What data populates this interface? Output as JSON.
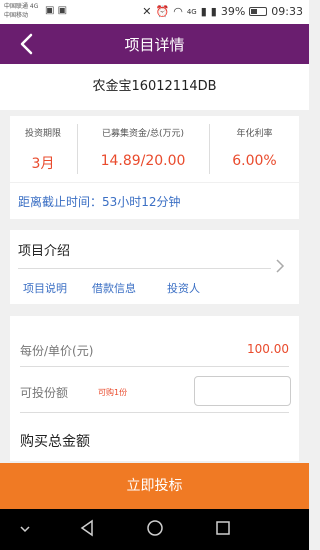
{
  "status_bar": {
    "carrier1": "中国联通 4G",
    "carrier2": "中国移动",
    "battery_percent": "39%",
    "time": "09:33",
    "network1": "4G",
    "battery_level": 0.39
  },
  "header": {
    "title": "项目详情"
  },
  "product": {
    "name": "农金宝16012114DB"
  },
  "stats": [
    {
      "label": "投资期限",
      "value": "3月"
    },
    {
      "label": "已募集资金/总(万元)",
      "value": "14.89/20.00"
    },
    {
      "label": "年化利率",
      "value": "6.00%"
    }
  ],
  "deadline": {
    "text": "距离截止时间：53小时12分钟"
  },
  "intro": {
    "heading": "项目介绍",
    "links": [
      "项目说明",
      "借款信息",
      "投资人"
    ]
  },
  "order": {
    "unit_price_label": "每份/单价(元)",
    "unit_price_value": "100.00",
    "shares_label": "可投份额",
    "shares_hint": "可购1份",
    "qty_value": "",
    "total_label": "购买总金额"
  },
  "cta": {
    "label": "立即投标"
  },
  "colors": {
    "brand_purple": "#6a1e6f",
    "accent_orange": "#f07a24",
    "value_red": "#e94b2d",
    "link_blue": "#3b6fc4"
  }
}
